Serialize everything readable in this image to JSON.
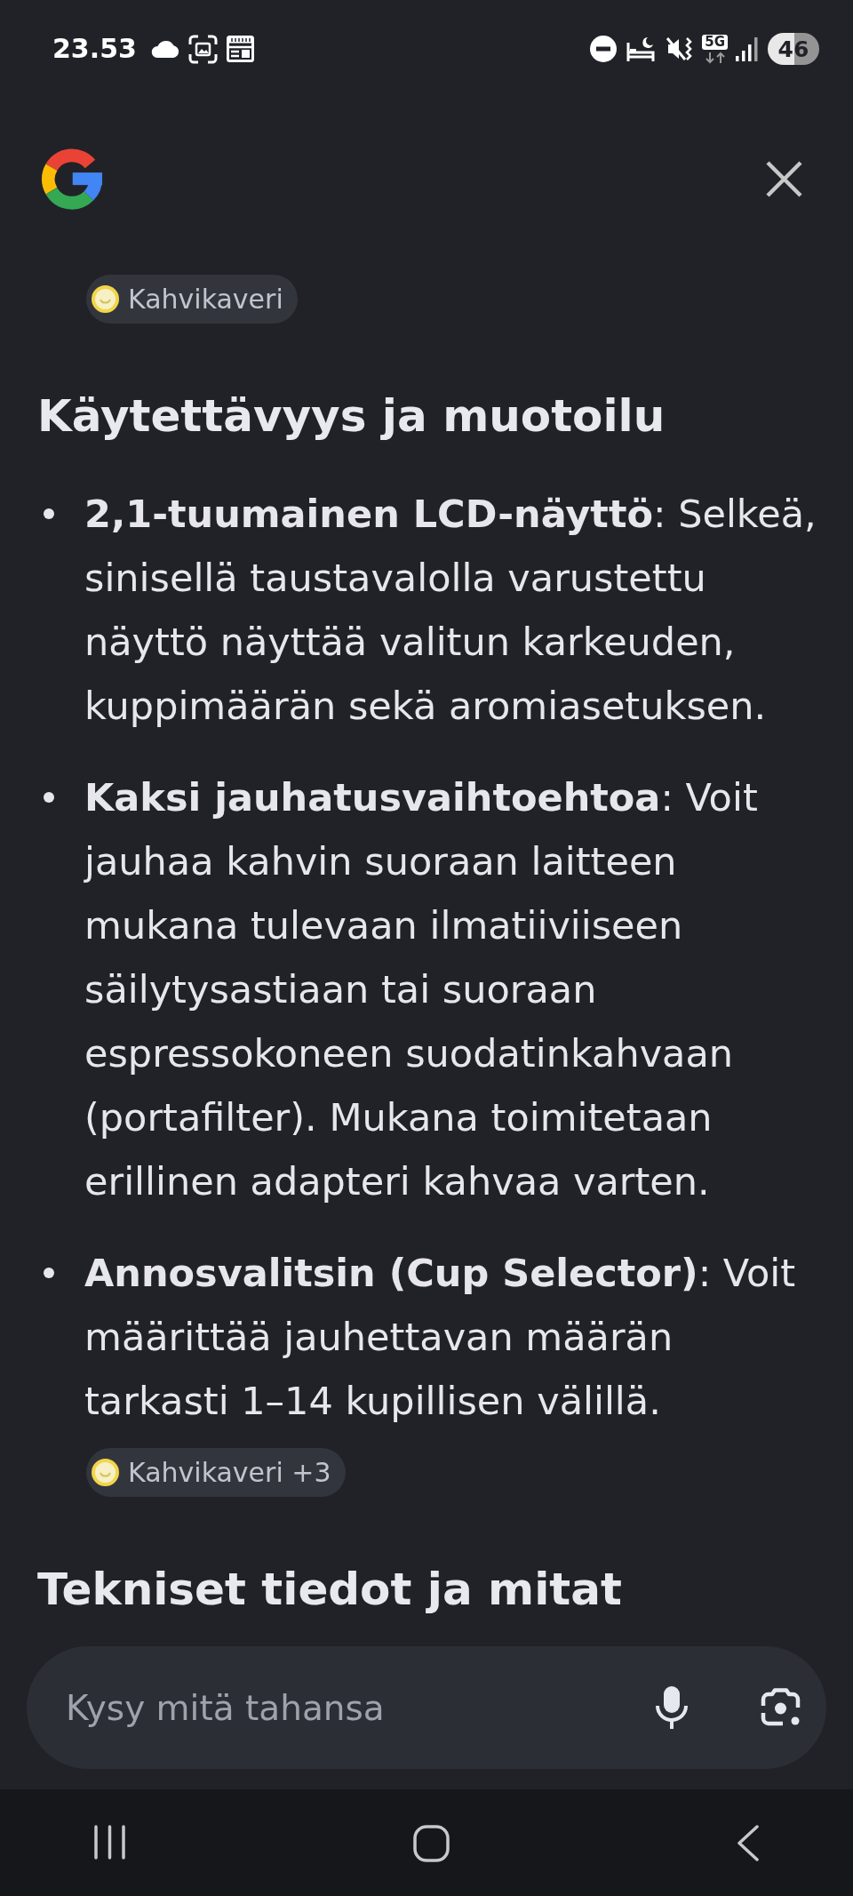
{
  "status_bar": {
    "time": "23.53",
    "network_type": "5G",
    "battery": "46"
  },
  "answer": [
    {
      "kind": "source_chip",
      "label": "Kahvikaveri"
    },
    {
      "kind": "heading",
      "text": "Käytettävyys ja muotoilu"
    },
    {
      "kind": "bullet_list",
      "items": [
        "**2,1-tuumainen LCD-näyttö**: Selkeä, sinisellä taustavalolla varustettu näyttö näyttää valitun karkeuden, kuppimäärän sekä aromiasetuksen.",
        "**Kaksi jauhatusvaihtoehtoa**: Voit jauhaa kahvin suoraan laitteen mukana tulevaan ilmatiiviiseen säilytysastiaan tai suoraan espressokoneen suodatinkahvaan (portafilter). Mukana toimitetaan erillinen adapteri kahvaa varten.",
        "**Annosvalitsin (Cup Selector)**: Voit määrittää jauhettavan määrän tarkasti 1–14 kupillisen välillä."
      ]
    },
    {
      "kind": "source_chip",
      "label": "Kahvikaveri +3"
    },
    {
      "kind": "heading",
      "text": "Tekniset tiedot ja mitat"
    }
  ],
  "composer": {
    "placeholder": "Kysy mitä tahansa"
  }
}
